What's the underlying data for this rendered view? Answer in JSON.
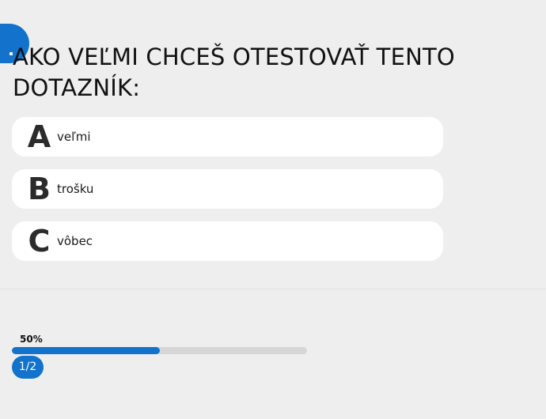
{
  "question": {
    "title": "Ako veľmi chceš otestovať tento dotazník:"
  },
  "answers": [
    {
      "letter": "A",
      "text": "veľmi"
    },
    {
      "letter": "B",
      "text": "trošku"
    },
    {
      "letter": "C",
      "text": "vôbec"
    }
  ],
  "progress": {
    "percent_label": "50%",
    "fraction": 0.5,
    "page_label": "1/2"
  },
  "colors": {
    "accent": "#1272cc",
    "background": "#eeeeee",
    "card": "#ffffff",
    "track": "#d6d6d6"
  }
}
